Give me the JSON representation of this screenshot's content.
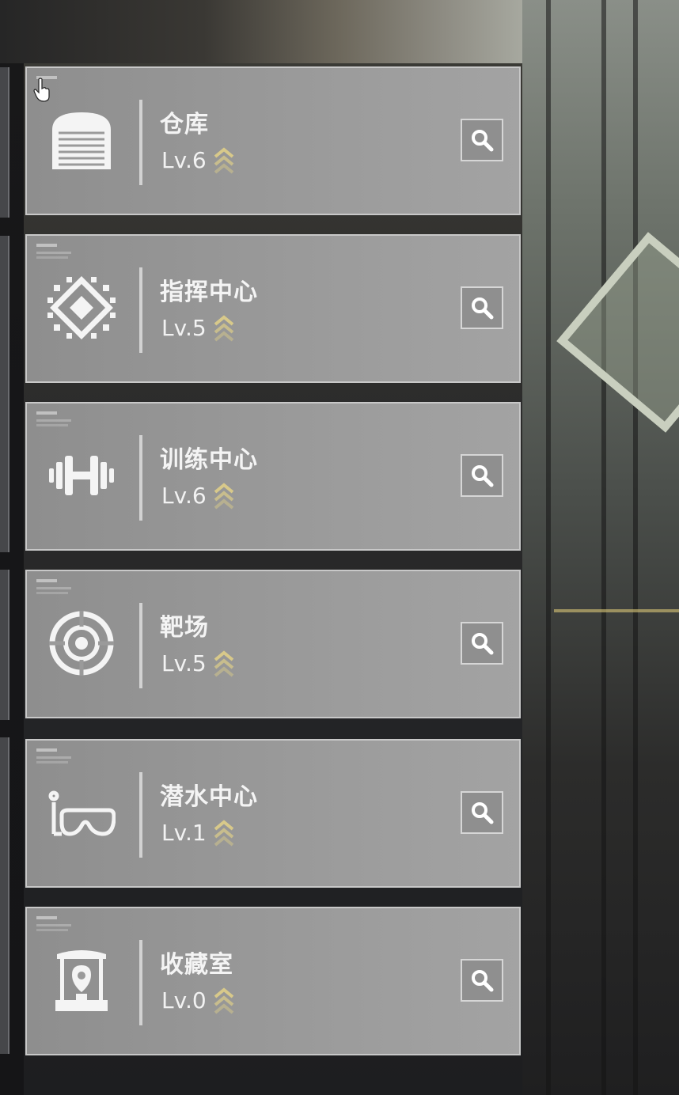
{
  "facilities": [
    {
      "name": "仓库",
      "level": "Lv.6",
      "icon": "warehouse-icon"
    },
    {
      "name": "指挥中心",
      "level": "Lv.5",
      "icon": "chip-icon"
    },
    {
      "name": "训练中心",
      "level": "Lv.6",
      "icon": "dumbbell-icon"
    },
    {
      "name": "靶场",
      "level": "Lv.5",
      "icon": "target-icon"
    },
    {
      "name": "潜水中心",
      "level": "Lv.1",
      "icon": "diving-mask-icon"
    },
    {
      "name": "收藏室",
      "level": "Lv.0",
      "icon": "display-case-icon"
    }
  ],
  "colors": {
    "panel": "#9a9a9a",
    "text": "#f4f4f4",
    "upgrade_chevron": "#d8c98a"
  }
}
